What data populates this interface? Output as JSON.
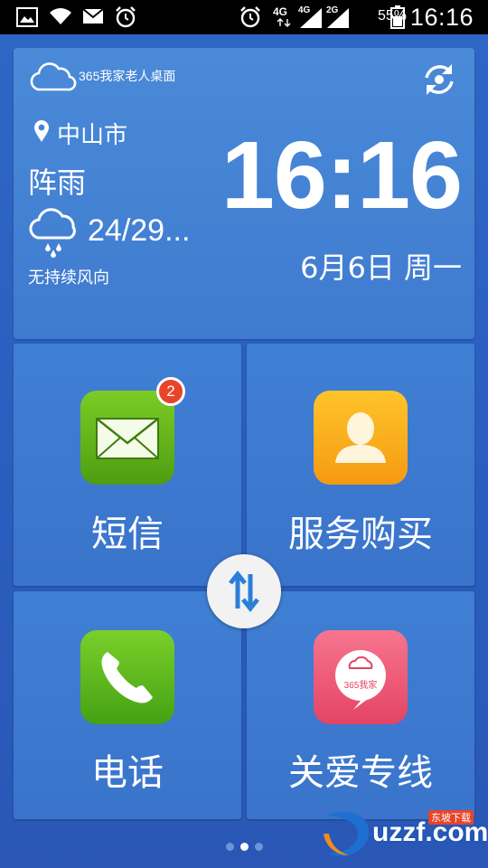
{
  "status_bar": {
    "network_4g": "4G",
    "sim1": "4G",
    "sim2": "2G",
    "battery": "55%",
    "time": "16:16"
  },
  "weather": {
    "brand_number": "365",
    "brand_name": "我家老人桌面",
    "city": "中山市",
    "condition": "阵雨",
    "temperature": "24/29...",
    "wind": "无持续风向",
    "clock": "16:16",
    "date": "6月6日 周一"
  },
  "tiles": {
    "sms": {
      "label": "短信",
      "badge": "2"
    },
    "shop": {
      "label": "服务购买"
    },
    "phone": {
      "label": "电话"
    },
    "care": {
      "label": "关爱专线",
      "icon_text": "365我家"
    }
  },
  "pager": {
    "pages": 3,
    "active": 1
  },
  "watermark": {
    "text": "uzzf.com",
    "sub": "东坡下载"
  },
  "colors": {
    "background": "#2f64c4",
    "tile": "#3d79cf",
    "sms_green": "#5aac17",
    "shop_orange": "#f8ac1c",
    "care_pink": "#ec5878",
    "badge_red": "#e8442a"
  }
}
